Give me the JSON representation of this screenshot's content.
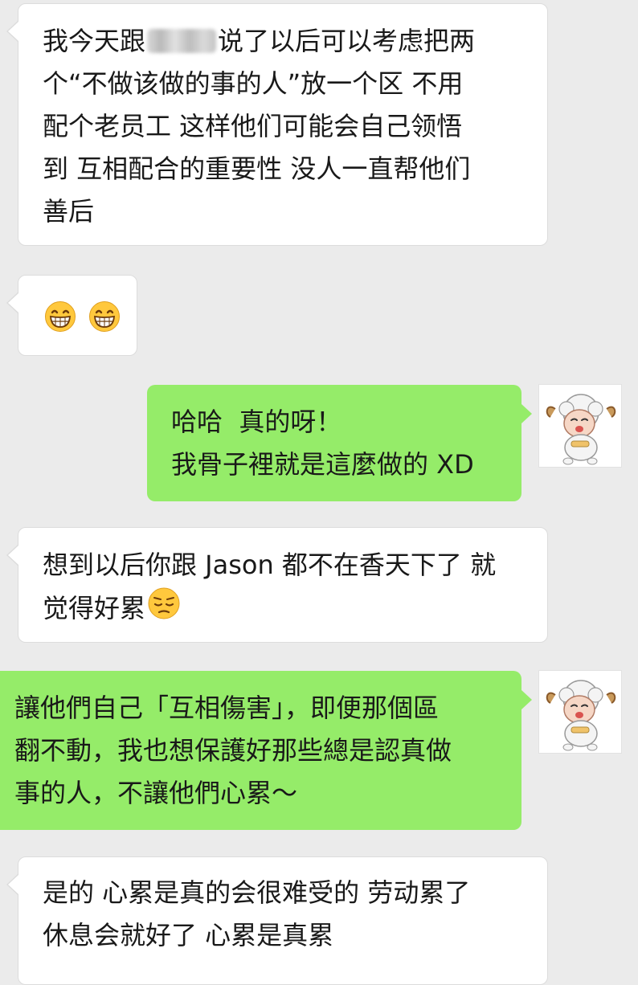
{
  "messages": [
    {
      "id": 1,
      "direction": "incoming",
      "lines": [
        {
          "before": "我今天跟",
          "after": "说了以后可以考虑把两"
        },
        "个“不做该做的事的人”放一个区 不用",
        "配个老员工 这样他们可能会自己领悟",
        "到 互相配合的重要性 没人一直帮他们",
        "善后"
      ]
    },
    {
      "id": 2,
      "direction": "incoming",
      "emoji": [
        "grinning-face-icon",
        "grinning-face-icon"
      ]
    },
    {
      "id": 3,
      "direction": "outgoing",
      "lines": [
        "哈哈  真的呀！",
        "我骨子裡就是這麼做的 XD"
      ]
    },
    {
      "id": 4,
      "direction": "incoming",
      "lines": [
        "想到以后你跟 Jason 都不在香天下了 就",
        "觉得好累"
      ],
      "trailing_emoji": "pensive-face-icon"
    },
    {
      "id": 5,
      "direction": "outgoing",
      "lines": [
        "讓他們自己「互相傷害」，即便那個區",
        "翻不動，我也想保護好那些總是認真做",
        "事的人，不讓他們心累～"
      ]
    },
    {
      "id": 6,
      "direction": "incoming",
      "lines": [
        "是的 心累是真的会很难受的 劳动累了",
        "休息会就好了 心累是真累"
      ]
    }
  ],
  "colors": {
    "background": "#ebebeb",
    "incoming_bubble": "#ffffff",
    "outgoing_bubble": "#95ec69",
    "text": "#191919"
  }
}
